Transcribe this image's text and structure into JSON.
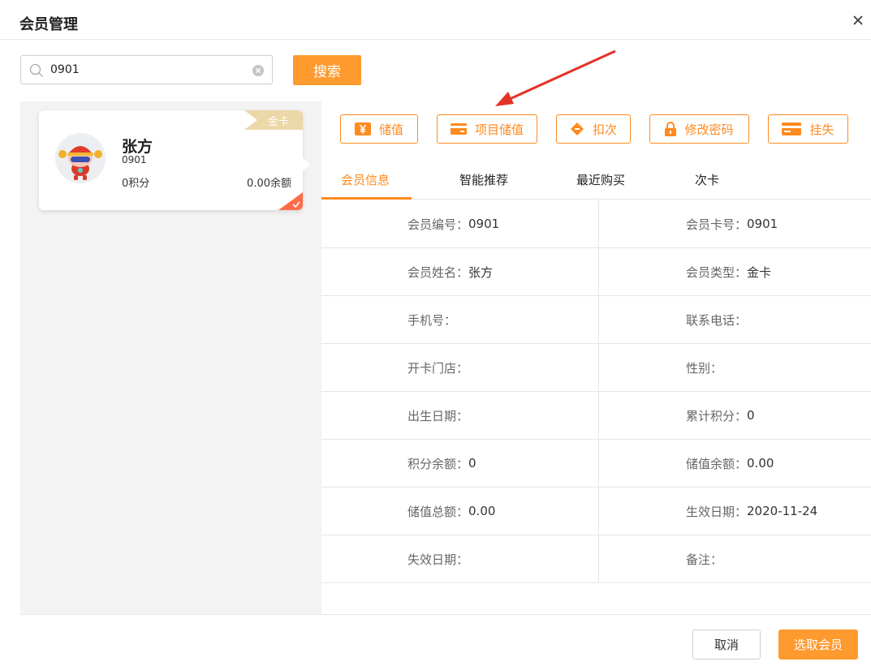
{
  "dialog": {
    "title": "会员管理",
    "close_icon": "close-icon"
  },
  "search": {
    "value": "0901",
    "button_label": "搜索",
    "icon": "search-icon",
    "clear_icon": "clear-icon"
  },
  "member_card": {
    "card_type": "金卡",
    "name": "张方",
    "number": "0901",
    "points": "0积分",
    "balance": "0.00余额",
    "selected": true
  },
  "actions": [
    {
      "label": "储值",
      "icon": "yuan-icon"
    },
    {
      "label": "项目储值",
      "icon": "card-icon"
    },
    {
      "label": "扣次",
      "icon": "ticket-icon"
    },
    {
      "label": "修改密码",
      "icon": "lock-icon"
    },
    {
      "label": "挂失",
      "icon": "credit-card-icon"
    }
  ],
  "tabs": [
    {
      "label": "会员信息",
      "active": true
    },
    {
      "label": "智能推荐",
      "active": false
    },
    {
      "label": "最近购买",
      "active": false
    },
    {
      "label": "次卡",
      "active": false
    }
  ],
  "info_rows": [
    [
      {
        "label": "会员编号：",
        "value": "0901"
      },
      {
        "label": "会员卡号：",
        "value": "0901"
      }
    ],
    [
      {
        "label": "会员姓名：",
        "value": "张方"
      },
      {
        "label": "会员类型：",
        "value": "金卡"
      }
    ],
    [
      {
        "label": "手机号：",
        "value": ""
      },
      {
        "label": "联系电话：",
        "value": ""
      }
    ],
    [
      {
        "label": "开卡门店：",
        "value": ""
      },
      {
        "label": "性别：",
        "value": ""
      }
    ],
    [
      {
        "label": "出生日期：",
        "value": ""
      },
      {
        "label": "累计积分：",
        "value": "0"
      }
    ],
    [
      {
        "label": "积分余额：",
        "value": "0"
      },
      {
        "label": "储值余额：",
        "value": "0.00"
      }
    ],
    [
      {
        "label": "储值总额：",
        "value": "0.00"
      },
      {
        "label": "生效日期：",
        "value": "2020-11-24"
      }
    ],
    [
      {
        "label": "失效日期：",
        "value": ""
      },
      {
        "label": "备注：",
        "value": ""
      }
    ]
  ],
  "footer": {
    "cancel_label": "取消",
    "select_label": "选取会员"
  },
  "colors": {
    "accent": "#ff8a1e",
    "primary_button": "#ff9a2e",
    "gold_badge": "#ecd7a6",
    "selected_corner": "#ff6d4a",
    "annotation_arrow": "#e53228"
  }
}
